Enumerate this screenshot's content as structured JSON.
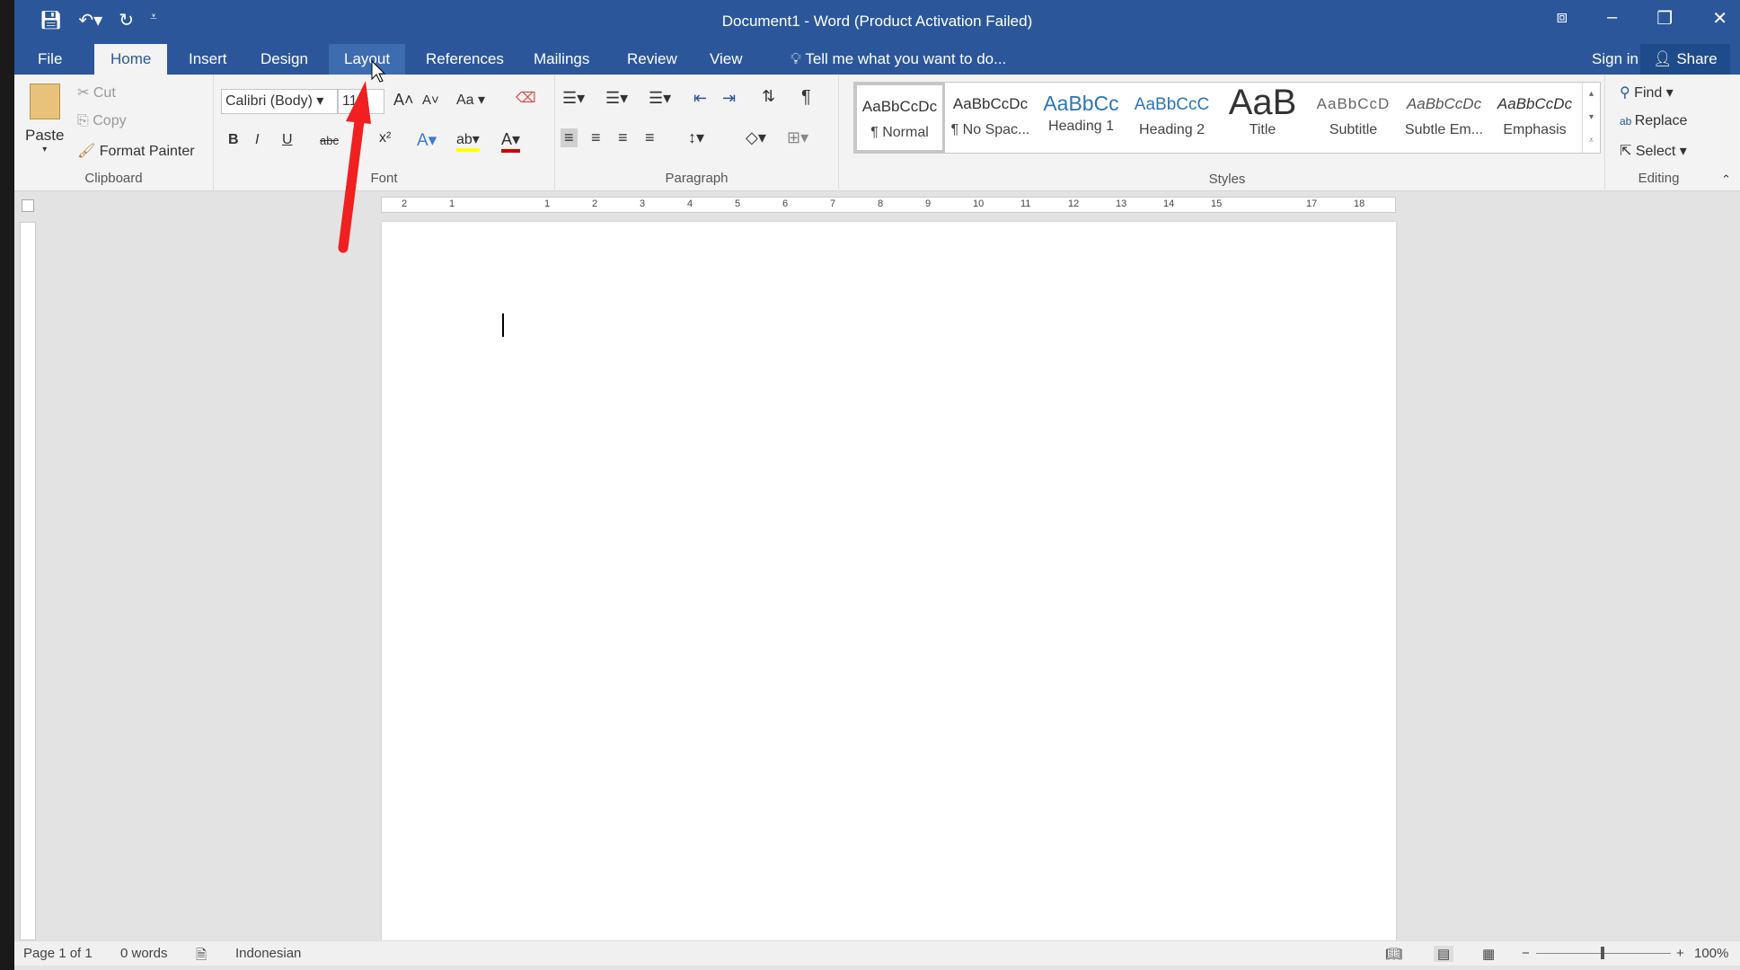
{
  "window": {
    "title": "Document1 - Word (Product Activation Failed)"
  },
  "qat": {
    "save_icon": "save-icon",
    "undo_icon": "undo-icon",
    "redo_icon": "redo-icon"
  },
  "tabs": [
    {
      "label": "File"
    },
    {
      "label": "Home"
    },
    {
      "label": "Insert"
    },
    {
      "label": "Design"
    },
    {
      "label": "Layout"
    },
    {
      "label": "References"
    },
    {
      "label": "Mailings"
    },
    {
      "label": "Review"
    },
    {
      "label": "View"
    }
  ],
  "tell_me": "Tell me what you want to do...",
  "sign_in": "Sign in",
  "share": "Share",
  "clipboard": {
    "paste": "Paste",
    "cut": "Cut",
    "copy": "Copy",
    "format_painter": "Format Painter",
    "label": "Clipboard"
  },
  "font": {
    "name": "Calibri (Body)",
    "size": "11",
    "change_case": "Aa",
    "label": "Font",
    "bold": "B",
    "italic": "I",
    "underline": "U",
    "strike": "abc",
    "superscript": "x²"
  },
  "paragraph": {
    "label": "Paragraph"
  },
  "styles": {
    "label": "Styles",
    "items": [
      {
        "preview": "AaBbCcDc",
        "name": "¶ Normal"
      },
      {
        "preview": "AaBbCcDc",
        "name": "¶ No Spac..."
      },
      {
        "preview": "AaBbCc",
        "name": "Heading 1"
      },
      {
        "preview": "AaBbCcC",
        "name": "Heading 2"
      },
      {
        "preview": "AaB",
        "name": "Title"
      },
      {
        "preview": "AaBbCcD",
        "name": "Subtitle"
      },
      {
        "preview": "AaBbCcDc",
        "name": "Subtle Em..."
      },
      {
        "preview": "AaBbCcDc",
        "name": "Emphasis"
      }
    ]
  },
  "editing": {
    "find": "Find",
    "replace": "Replace",
    "select": "Select",
    "label": "Editing"
  },
  "ruler": {
    "marks": [
      "2",
      "1",
      "",
      "1",
      "2",
      "3",
      "4",
      "5",
      "6",
      "7",
      "8",
      "9",
      "10",
      "11",
      "12",
      "13",
      "14",
      "15",
      "",
      "17",
      "18"
    ]
  },
  "status": {
    "page": "Page 1 of 1",
    "words": "0 words",
    "language": "Indonesian",
    "zoom": "100%"
  },
  "colors": {
    "brand": "#2b579a",
    "annotation_arrow": "#f02020"
  }
}
